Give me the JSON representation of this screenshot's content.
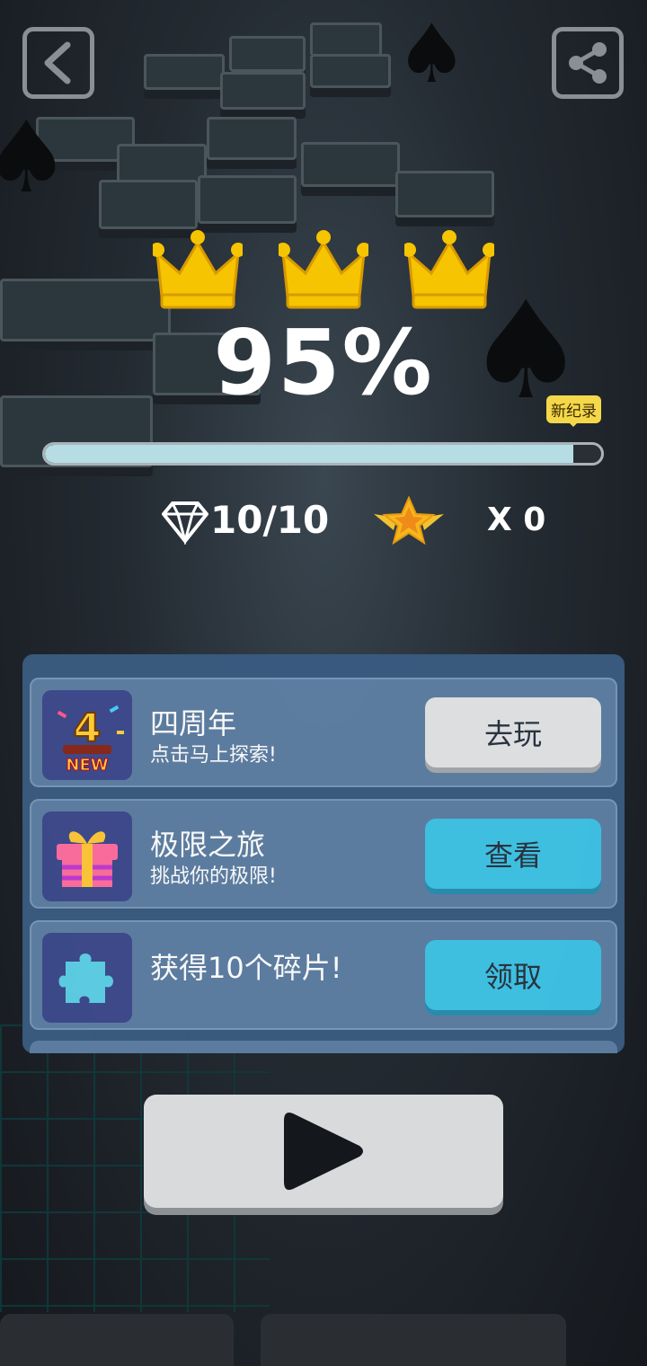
{
  "progress": {
    "percent_label": "95%",
    "fraction": 0.95,
    "badge": "新纪录"
  },
  "stats": {
    "diamonds": "10/10",
    "stars": "X 0"
  },
  "crowns_earned": 3,
  "tasks": [
    {
      "title": "四周年",
      "subtitle": "点击马上探索!",
      "button": "去玩",
      "thumb_text": "4",
      "thumb_badge": "NEW"
    },
    {
      "title": "极限之旅",
      "subtitle": "挑战你的极限!",
      "button": "查看"
    },
    {
      "title": "获得10个碎片!",
      "button": "领取"
    }
  ],
  "colors": {
    "crown": "#f6c400",
    "progress_fill": "#b6dde4",
    "cyan_button": "#3fc4e6",
    "panel": "#3a5b80"
  },
  "icons": {
    "back": "back-arrow-icon",
    "share": "share-icon",
    "diamond": "diamond-icon",
    "star": "winged-star-icon",
    "play": "play-icon",
    "gift": "gift-icon",
    "puzzle": "puzzle-icon"
  }
}
